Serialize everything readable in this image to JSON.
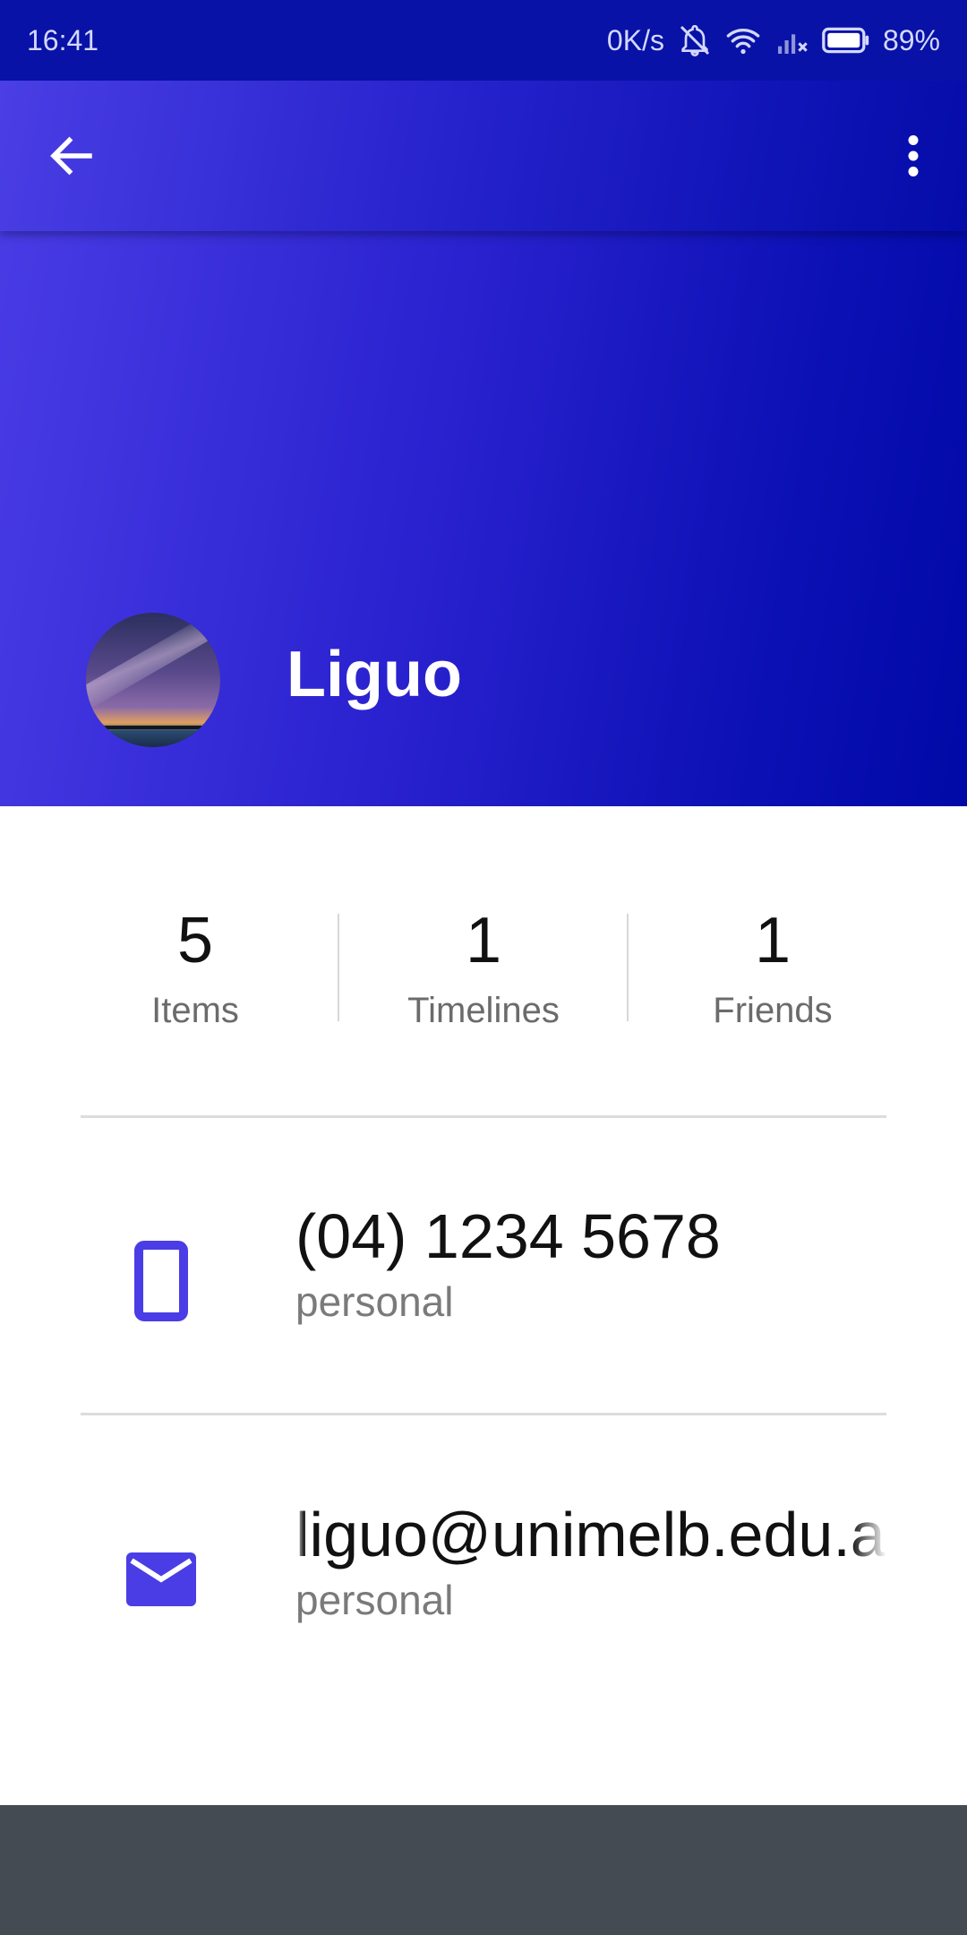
{
  "status_bar": {
    "time": "16:41",
    "net_speed": "0K/s",
    "battery": "89%",
    "icons": [
      "bell-off-icon",
      "wifi-icon",
      "signal-icon",
      "battery-icon"
    ]
  },
  "toolbar": {
    "back_icon": "arrow-left-icon",
    "more_icon": "more-vert-icon"
  },
  "profile": {
    "name": "Liguo",
    "avatar": "starry-sky-avatar"
  },
  "stats": [
    {
      "value": "5",
      "label": "Items"
    },
    {
      "value": "1",
      "label": "Timelines"
    },
    {
      "value": "1",
      "label": "Friends"
    }
  ],
  "contacts": [
    {
      "icon": "phone-icon",
      "value": "(04) 1234 5678",
      "type": "personal"
    },
    {
      "icon": "email-icon",
      "value": "liguo@unimelb.edu.au",
      "type": "personal"
    }
  ],
  "colors": {
    "accent": "#4a3de6",
    "header_dark": "#0009a6",
    "status_bar": "#0812a6",
    "bottom_bar": "#454b53"
  }
}
